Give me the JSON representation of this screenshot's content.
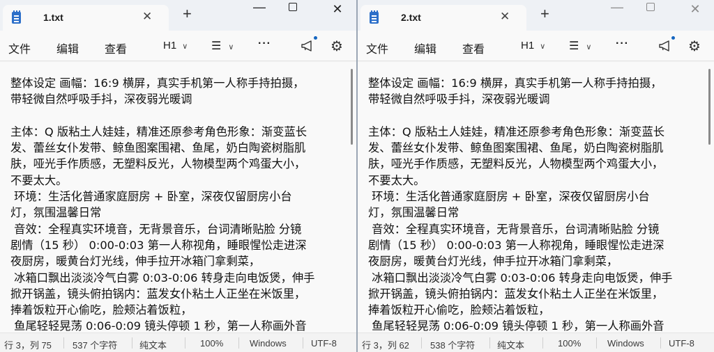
{
  "windows": [
    {
      "tab_title": "1.txt",
      "menu": {
        "file": "文件",
        "edit": "编辑",
        "view": "查看",
        "heading": "H1"
      },
      "lines": [
        "整体设定 画幅：16:9 横屏，真实手机第一人称手持拍摄，",
        "带轻微自然呼吸手抖，深夜弱光暖调",
        "",
        "主体：Q 版粘土人娃娃，精准还原参考角色形象：渐变蓝长",
        "发、蕾丝女仆发带、鲸鱼图案围裙、鱼尾，奶白陶瓷树脂肌",
        "肤，哑光手作质感，无塑料反光，人物模型两个鸡蛋大小，",
        "不要太大。",
        " 环境：生活化普通家庭厨房 + 卧室，深夜仅留厨房小台",
        "灯，氛围温馨日常",
        " 音效：全程真实环境音，无背景音乐，台词清晰贴脸 分镜",
        "剧情（15 秒） 0:00-0:03 第一人称视角，睡眼惺忪走进深",
        "夜厨房，暖黄台灯光线，伸手拉开冰箱门拿剩菜，",
        " 冰箱口飘出淡淡冷气白雾 0:03-0:06 转身走向电饭煲，伸手",
        "掀开锅盖，镜头俯拍锅内：蓝发女仆粘土人正坐在米饭里，",
        "捧着饭粒开心偷吃，脸颊沾着饭粒，",
        " 鱼尾轻轻晃荡 0:06-0:09 镜头停顿 1 秒，第一人称画外音"
      ],
      "status": {
        "position": "行 3，列 75",
        "count": "537 个字符",
        "format": "纯文本",
        "zoom": "100%",
        "eol": "Windows",
        "encoding": "UTF-8"
      }
    },
    {
      "tab_title": "2.txt",
      "menu": {
        "file": "文件",
        "edit": "编辑",
        "view": "查看",
        "heading": "H1"
      },
      "lines": [
        "整体设定 画幅：16:9 横屏，真实手机第一人称手持拍摄，",
        "带轻微自然呼吸手抖，深夜弱光暖调",
        "",
        "主体：Q 版粘土人娃娃，精准还原参考角色形象：渐变蓝长",
        "发、蕾丝女仆发带、鲸鱼图案围裙、鱼尾，奶白陶瓷树脂肌",
        "肤，哑光手作质感，无塑料反光，人物模型两个鸡蛋大小，",
        "不要太大。",
        " 环境：生活化普通家庭厨房 + 卧室，深夜仅留厨房小台",
        "灯，氛围温馨日常",
        " 音效：全程真实环境音，无背景音乐，台词清晰贴脸 分镜",
        "剧情（15 秒） 0:00-0:03 第一人称视角，睡眼惺忪走进深",
        "夜厨房，暖黄台灯光线，伸手拉开冰箱门拿剩菜，",
        " 冰箱口飘出淡淡冷气白雾 0:03-0:06 转身走向电饭煲，伸手",
        "掀开锅盖，镜头俯拍锅内：蓝发女仆粘土人正坐在米饭里，",
        "捧着饭粒开心偷吃，脸颊沾着饭粒，",
        " 鱼尾轻轻晃荡 0:06-0:09 镜头停顿 1 秒，第一人称画外音"
      ],
      "status": {
        "position": "行 3，列 62",
        "count": "538 个字符",
        "format": "纯文本",
        "zoom": "100%",
        "eol": "Windows",
        "encoding": "UTF-8"
      }
    }
  ],
  "colors": {
    "accent": "#2c6fc9",
    "notification_dot": "#1565c0"
  }
}
